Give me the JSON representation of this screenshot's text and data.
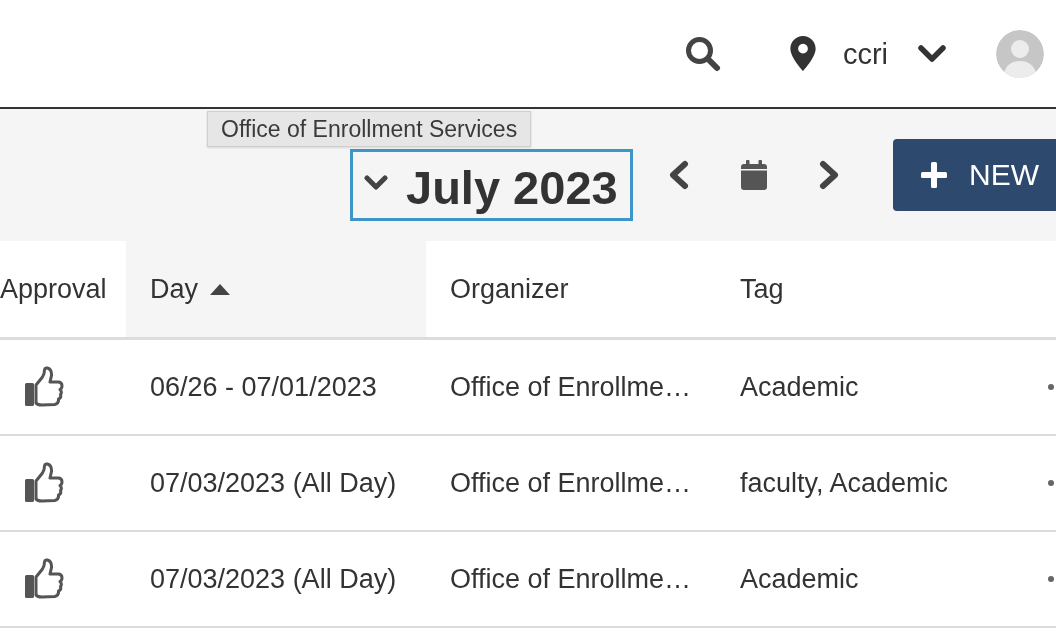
{
  "top_bar": {
    "location": "ccri"
  },
  "toolbar": {
    "month_picker": {
      "label": "July 2023",
      "focused": true
    },
    "new_button": {
      "label": "NEW"
    }
  },
  "tooltip": "Office of Enrollment Services",
  "table": {
    "columns": [
      {
        "label": "Approval",
        "sorted": false
      },
      {
        "label": "Day",
        "sorted": true
      },
      {
        "label": "Organizer",
        "sorted": false
      },
      {
        "label": "Tag",
        "sorted": false
      }
    ],
    "rows": [
      {
        "day": "06/26 - 07/01/2023",
        "organizer": "Office of Enrollme…",
        "tag": "Academic"
      },
      {
        "day": "07/03/2023 (All Day)",
        "organizer": "Office of Enrollme…",
        "tag": "faculty, Academic"
      },
      {
        "day": "07/03/2023 (All Day)",
        "organizer": "Office of Enrollme…",
        "tag": "Academic"
      }
    ]
  }
}
